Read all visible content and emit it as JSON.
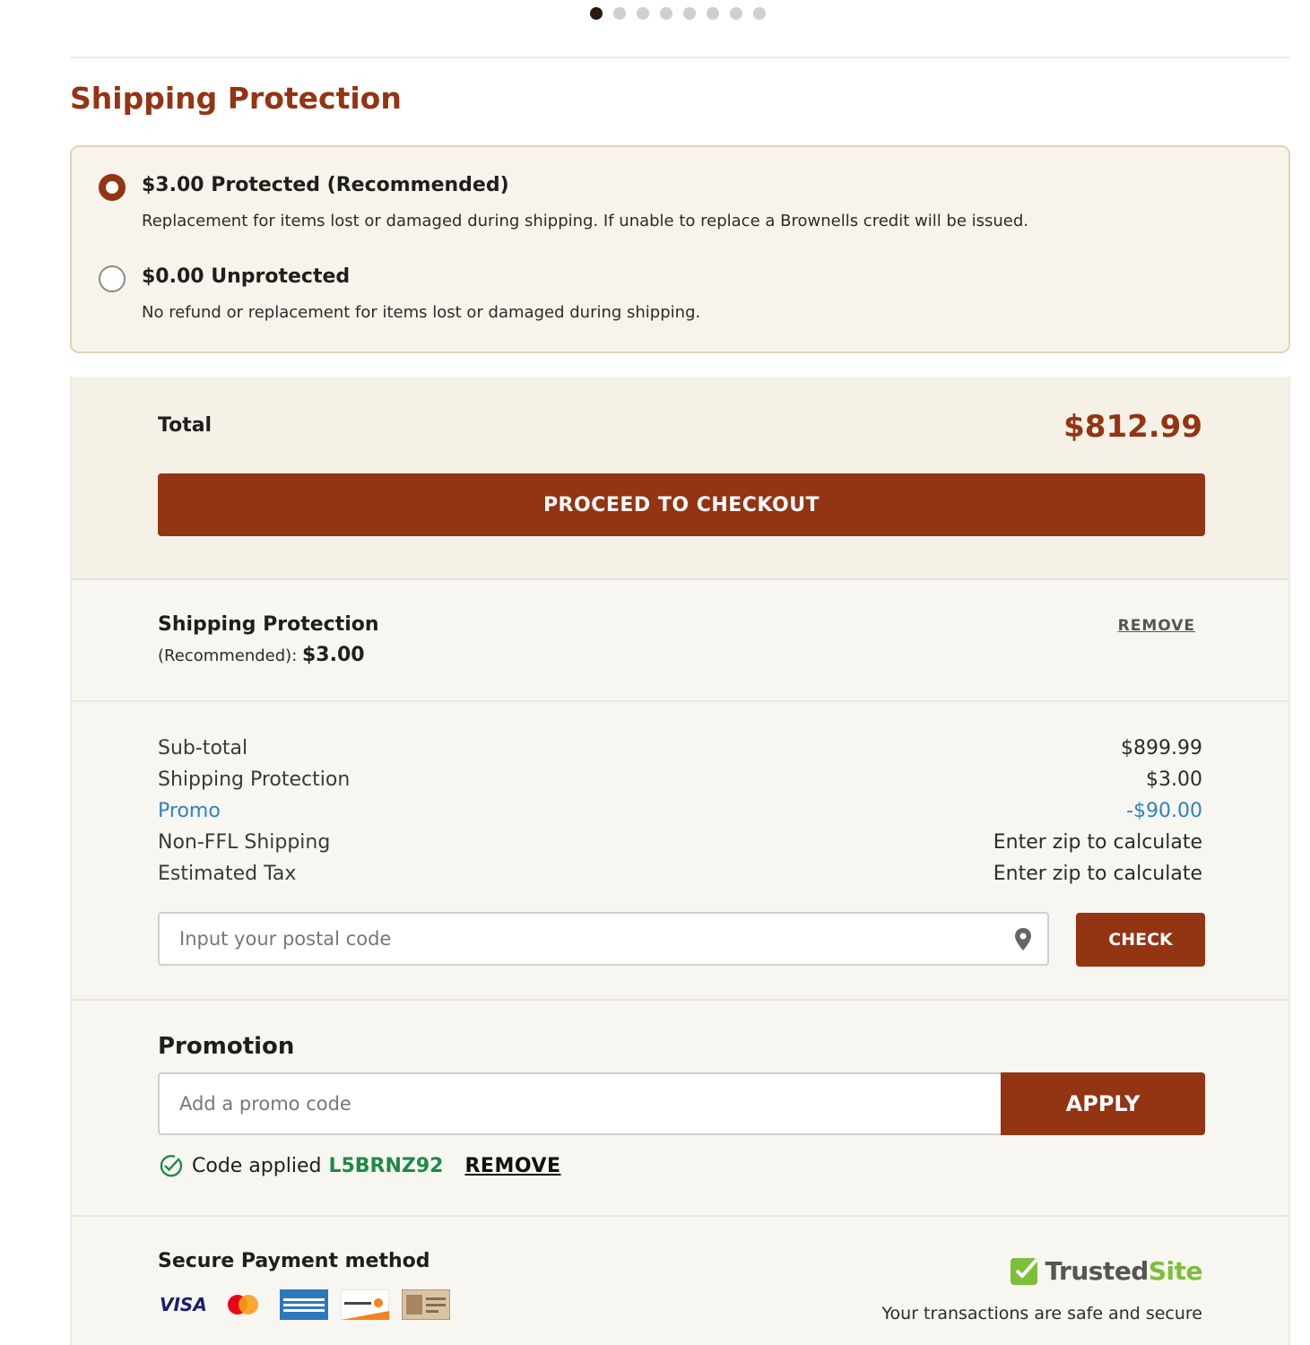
{
  "carousel": {
    "total_dots": 8,
    "active_index": 0
  },
  "shipping_protection": {
    "title": "Shipping Protection",
    "options": [
      {
        "title": "$3.00 Protected (Recommended)",
        "description": "Replacement for items lost or damaged during shipping. If unable to replace a Brownells credit will be issued.",
        "selected": true
      },
      {
        "title": "$0.00 Unprotected",
        "description": "No refund or replacement for items lost or damaged during shipping.",
        "selected": false
      }
    ]
  },
  "summary": {
    "total_label": "Total",
    "total_value": "$812.99",
    "checkout_label": "PROCEED TO CHECKOUT",
    "protection_line": {
      "title": "Shipping Protection",
      "sub_label": "(Recommended): ",
      "sub_value": "$3.00",
      "remove_label": "REMOVE"
    },
    "rows": [
      {
        "label": "Sub-total",
        "value": "$899.99"
      },
      {
        "label": "Shipping Protection",
        "value": "$3.00"
      },
      {
        "label": "Promo",
        "value": "-$90.00"
      },
      {
        "label": "Non-FFL Shipping",
        "value": "Enter zip to calculate"
      },
      {
        "label": "Estimated Tax",
        "value": "Enter zip to calculate"
      }
    ],
    "postal_placeholder": "Input your postal code",
    "check_label": "CHECK"
  },
  "promotion": {
    "title": "Promotion",
    "input_placeholder": "Add a promo code",
    "apply_label": "APPLY",
    "applied_text": "Code applied",
    "applied_code": "L5BRNZ92",
    "remove_label": "REMOVE"
  },
  "payment": {
    "title": "Secure Payment method",
    "cards": [
      "visa-icon",
      "mastercard-icon",
      "amex-icon",
      "discover-icon",
      "gift-card-icon"
    ],
    "trusted_prefix": "Trusted",
    "trusted_suffix": "Site",
    "safe_text": "Your transactions are safe and secure"
  },
  "colors": {
    "brand": "#933413",
    "panel": "#f8f4eb",
    "promo_blue": "#2e83c0",
    "code_green": "#1f8a47"
  }
}
